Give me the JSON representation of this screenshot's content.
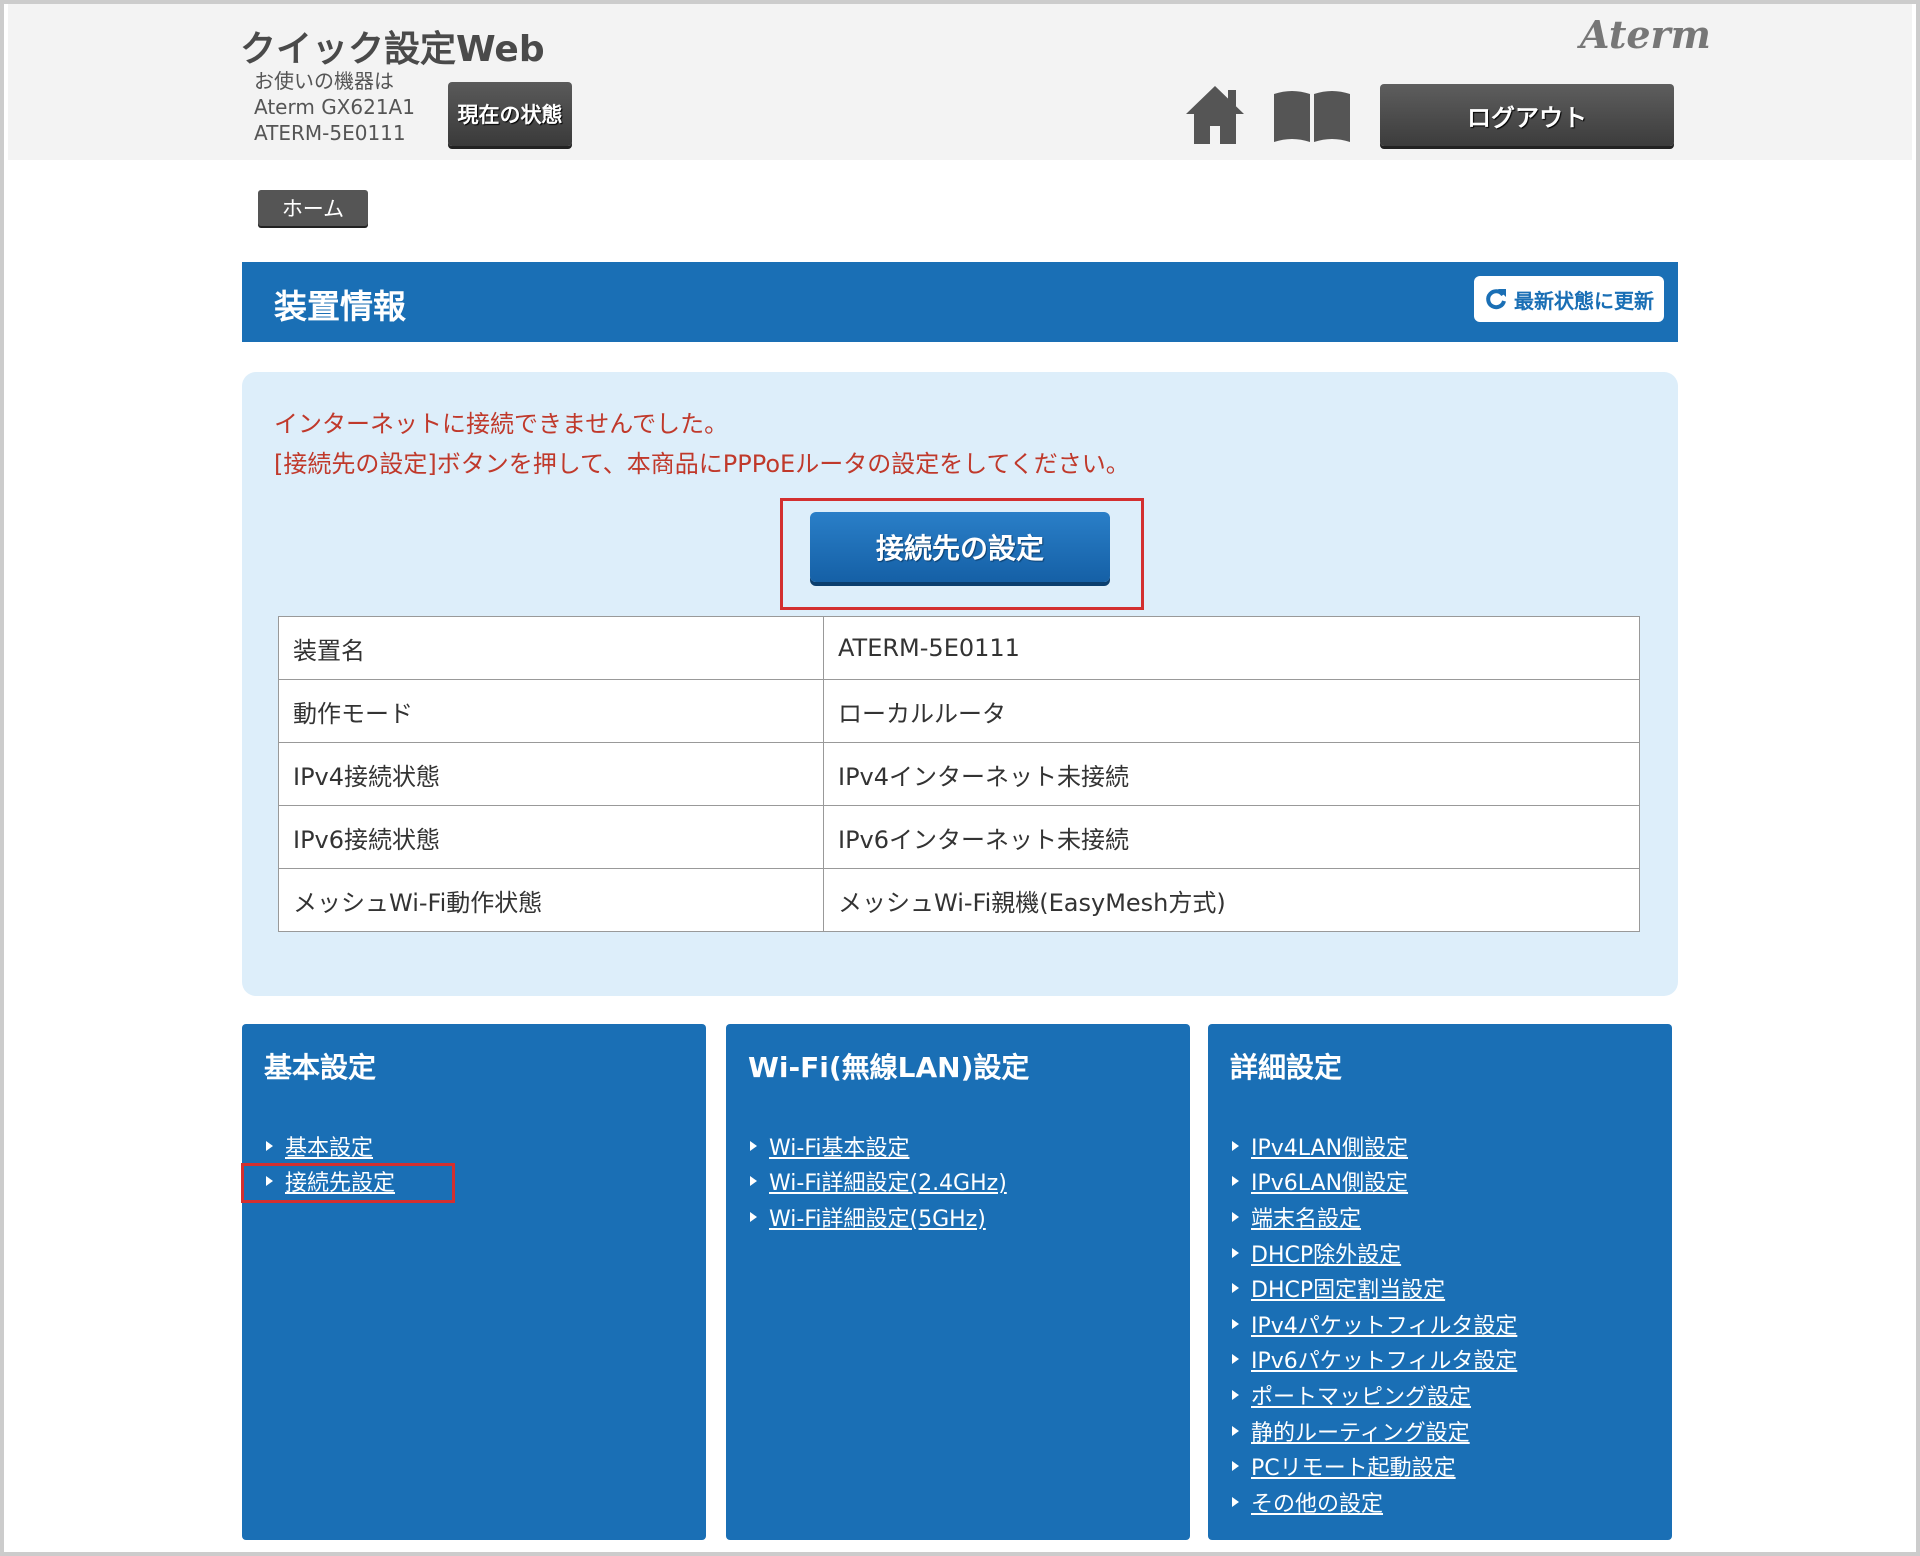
{
  "header": {
    "app_title": "クイック設定Web",
    "device_intro": "お使いの機器は",
    "model": "Aterm GX621A1",
    "device_id": "ATERM-5E0111",
    "status_button": "現在の状態",
    "brand": "Aterm",
    "logout_button": "ログアウト"
  },
  "icons": {
    "home": "home-icon",
    "manual": "book-icon",
    "refresh": "refresh-icon"
  },
  "breadcrumb": {
    "home": "ホーム"
  },
  "section": {
    "title": "装置情報",
    "refresh_button": "最新状態に更新"
  },
  "notice": {
    "line1": "インターネットに接続できませんでした。",
    "line2": "[接続先の設定]ボタンを押して、本商品にPPPoEルータの設定をしてください。"
  },
  "connect_button": "接続先の設定",
  "info_table": [
    {
      "key": "装置名",
      "value": "ATERM-5E0111"
    },
    {
      "key": "動作モード",
      "value": "ローカルルータ"
    },
    {
      "key": "IPv4接続状態",
      "value": "IPv4インターネット未接続"
    },
    {
      "key": "IPv6接続状態",
      "value": "IPv6インターネット未接続"
    },
    {
      "key": "メッシュWi-Fi動作状態",
      "value": "メッシュWi-Fi親機(EasyMesh方式)"
    }
  ],
  "cards": [
    {
      "title": "基本設定",
      "links": [
        "基本設定",
        "接続先設定"
      ]
    },
    {
      "title": "Wi-Fi(無線LAN)設定",
      "links": [
        "Wi-Fi基本設定",
        "Wi-Fi詳細設定(2.4GHz)",
        "Wi-Fi詳細設定(5GHz)"
      ]
    },
    {
      "title": "詳細設定",
      "links": [
        "IPv4LAN側設定",
        "IPv6LAN側設定",
        "端末名設定",
        "DHCP除外設定",
        "DHCP固定割当設定",
        "IPv4パケットフィルタ設定",
        "IPv6パケットフィルタ設定",
        "ポートマッピング設定",
        "静的ルーティング設定",
        "PCリモート起動設定",
        "その他の設定"
      ]
    }
  ],
  "colors": {
    "primary": "#1a6fb5",
    "panel_bg": "#ddeefa",
    "notice": "#c0392b",
    "highlight": "#d32f2f"
  }
}
